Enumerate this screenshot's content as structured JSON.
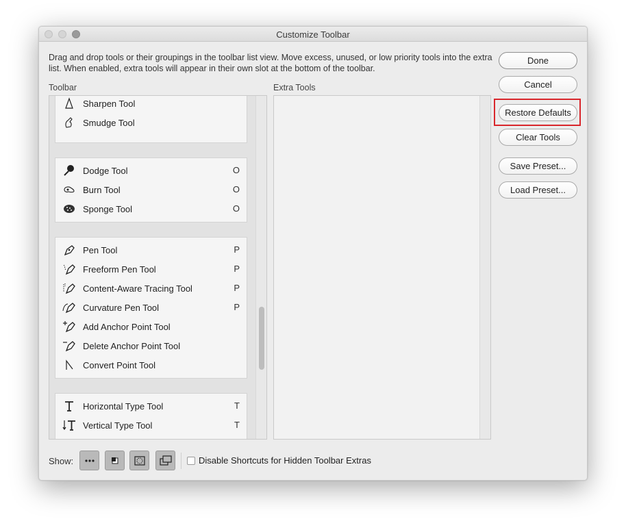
{
  "window": {
    "title": "Customize Toolbar"
  },
  "description": "Drag and drop tools or their groupings in the toolbar list view. Move excess, unused, or low priority tools into the extra list. When enabled, extra tools will appear in their own slot at the bottom of the toolbar.",
  "labels": {
    "toolbar": "Toolbar",
    "extra_tools": "Extra Tools"
  },
  "groups": [
    {
      "tools": [
        {
          "name": "Sharpen Tool",
          "key": "",
          "icon": "sharpen-icon"
        },
        {
          "name": "Smudge Tool",
          "key": "",
          "icon": "smudge-icon"
        }
      ]
    },
    {
      "tools": [
        {
          "name": "Dodge Tool",
          "key": "O",
          "icon": "dodge-icon"
        },
        {
          "name": "Burn Tool",
          "key": "O",
          "icon": "burn-icon"
        },
        {
          "name": "Sponge Tool",
          "key": "O",
          "icon": "sponge-icon"
        }
      ]
    },
    {
      "tools": [
        {
          "name": "Pen Tool",
          "key": "P",
          "icon": "pen-icon"
        },
        {
          "name": "Freeform Pen Tool",
          "key": "P",
          "icon": "freeform-pen-icon"
        },
        {
          "name": "Content-Aware Tracing Tool",
          "key": "P",
          "icon": "content-aware-tracing-icon"
        },
        {
          "name": "Curvature Pen Tool",
          "key": "P",
          "icon": "curvature-pen-icon"
        },
        {
          "name": "Add Anchor Point Tool",
          "key": "",
          "icon": "add-anchor-point-icon"
        },
        {
          "name": "Delete Anchor Point Tool",
          "key": "",
          "icon": "delete-anchor-point-icon"
        },
        {
          "name": "Convert Point Tool",
          "key": "",
          "icon": "convert-point-icon"
        }
      ]
    },
    {
      "tools": [
        {
          "name": "Horizontal Type Tool",
          "key": "T",
          "icon": "horizontal-type-icon"
        },
        {
          "name": "Vertical Type Tool",
          "key": "T",
          "icon": "vertical-type-icon"
        }
      ]
    }
  ],
  "buttons": {
    "done": "Done",
    "cancel": "Cancel",
    "restore_defaults": "Restore Defaults",
    "clear_tools": "Clear Tools",
    "save_preset": "Save Preset...",
    "load_preset": "Load Preset..."
  },
  "bottom": {
    "show_label": "Show:",
    "show_options": [
      "more-options-icon",
      "foreground-background-icon",
      "quick-mask-icon",
      "screen-mode-icon"
    ],
    "disable_shortcuts_label": "Disable Shortcuts for Hidden Toolbar Extras",
    "disable_shortcuts_checked": false
  },
  "colors": {
    "highlight": "#d9262b",
    "window_bg": "#ececec"
  }
}
